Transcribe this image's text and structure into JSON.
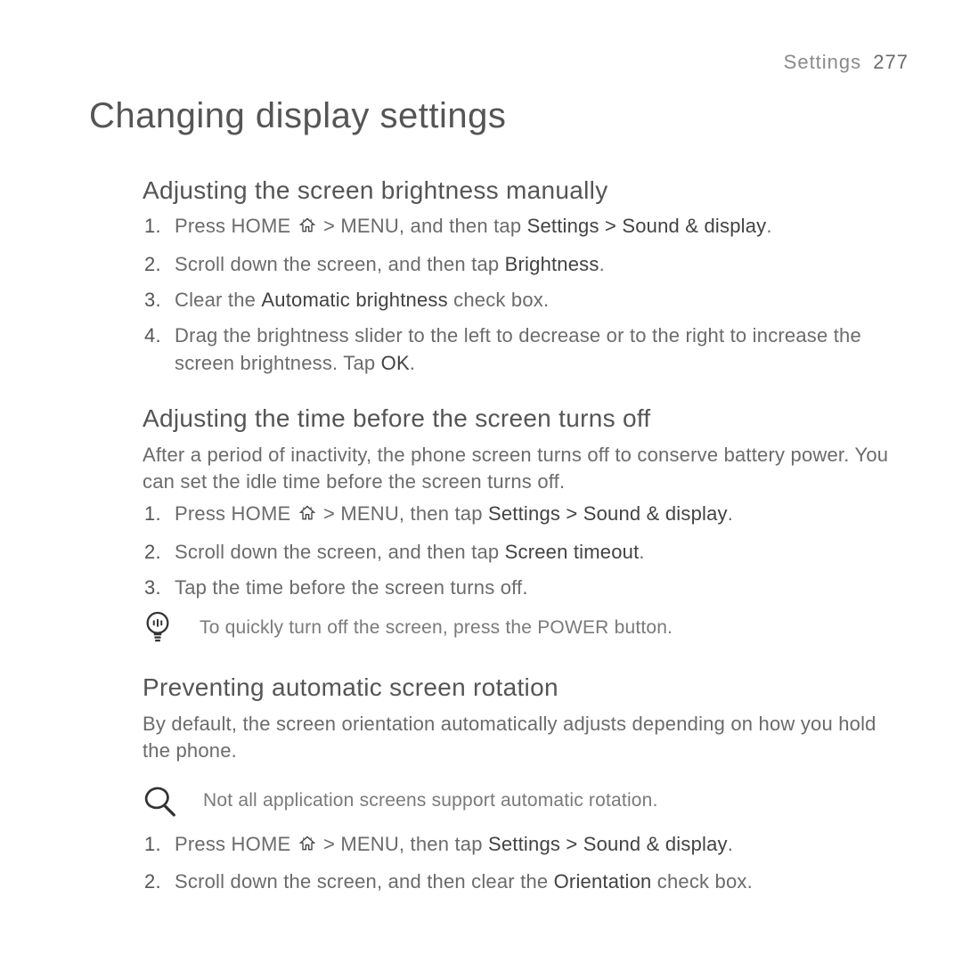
{
  "header": {
    "section": "Settings",
    "page": "277"
  },
  "title": "Changing display settings",
  "sec1": {
    "heading": "Adjusting the screen brightness manually",
    "s1a": "Press HOME ",
    "s1b": " > MENU, and then tap ",
    "s1c": "Settings > Sound & display",
    "s1d": ".",
    "s2a": "Scroll down the screen, and then tap ",
    "s2b": "Brightness",
    "s2c": ".",
    "s3a": "Clear the ",
    "s3b": "Automatic brightness",
    "s3c": " check box.",
    "s4a": "Drag the brightness slider to the left to decrease or to the right to increase the screen brightness. Tap ",
    "s4b": "OK",
    "s4c": "."
  },
  "sec2": {
    "heading": "Adjusting the time before the screen turns off",
    "intro": "After a period of inactivity, the phone screen turns off to conserve battery power. You can set the idle time before the screen turns off.",
    "s1a": "Press HOME ",
    "s1b": " > MENU, then tap ",
    "s1c": "Settings > Sound & display",
    "s1d": ".",
    "s2a": "Scroll down the screen, and then tap ",
    "s2b": "Screen timeout",
    "s2c": ".",
    "s3": "Tap the time before the screen turns off.",
    "tip": "To quickly turn off the screen, press the POWER button."
  },
  "sec3": {
    "heading": "Preventing automatic screen rotation",
    "intro": "By default, the screen orientation automatically adjusts depending on how you hold the phone.",
    "note": "Not all application screens support automatic rotation.",
    "s1a": "Press HOME ",
    "s1b": " > MENU, then tap ",
    "s1c": "Settings > Sound & display",
    "s1d": ".",
    "s2a": "Scroll down the screen, and then clear the ",
    "s2b": "Orientation",
    "s2c": " check box."
  }
}
